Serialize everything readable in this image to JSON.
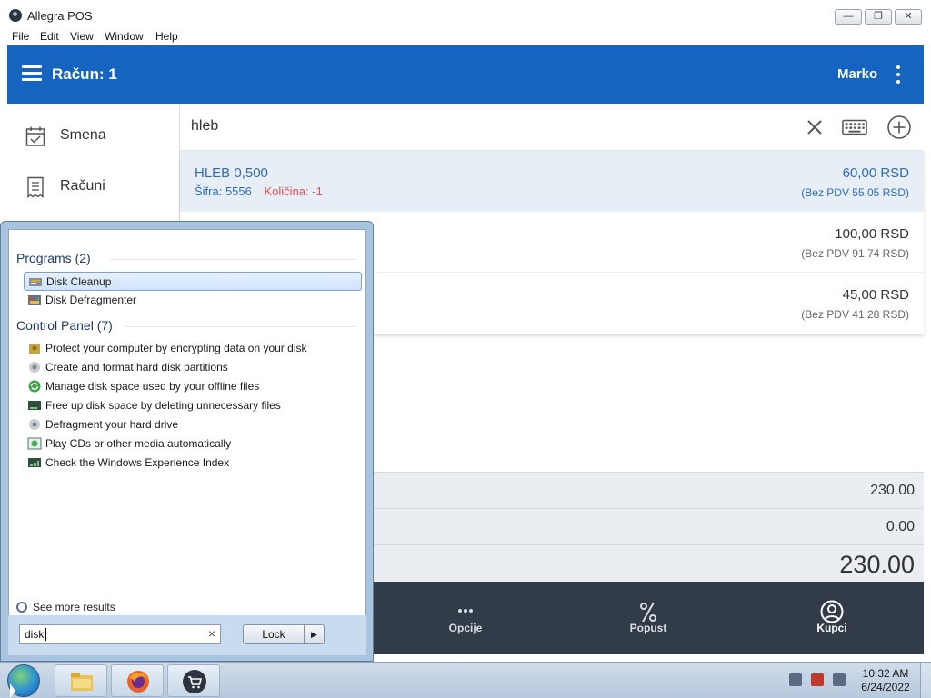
{
  "window": {
    "title": "Allegra POS",
    "controls": [
      "—",
      "❐",
      "✕"
    ]
  },
  "menu": [
    "File",
    "Edit",
    "View",
    "Window",
    "Help"
  ],
  "header": {
    "title": "Račun: 1",
    "user": "Marko"
  },
  "nav": [
    {
      "label": "Smena",
      "icon": "calendar-check-icon"
    },
    {
      "label": "Računi",
      "icon": "receipt-icon"
    }
  ],
  "search": {
    "query": "hleb"
  },
  "items": [
    {
      "name": "HLEB 0,500",
      "code_label": "Šifra: 5556",
      "qty_label": "Količina: -1",
      "price": "60,00 RSD",
      "net": "(Bez PDV 55,05 RSD)"
    },
    {
      "name": "",
      "price": "100,00 RSD",
      "net": "(Bez PDV 91,74 RSD)"
    },
    {
      "name": "",
      "price": "45,00 RSD",
      "net": "(Bez PDV 41,28 RSD)"
    }
  ],
  "totals": [
    "230.00",
    "0.00",
    "230.00"
  ],
  "actions": [
    {
      "label": "Opcije",
      "icon": "more-icon"
    },
    {
      "label": "Popust",
      "icon": "percent-icon"
    },
    {
      "label": "Kupci",
      "icon": "user-circle-icon"
    }
  ],
  "startmenu": {
    "programs_header": "Programs (2)",
    "programs": [
      "Disk Cleanup",
      "Disk Defragmenter"
    ],
    "control_header": "Control Panel (7)",
    "control": [
      "Protect your computer by encrypting data on your disk",
      "Create and format hard disk partitions",
      "Manage disk space used by your offline files",
      "Free up disk space by deleting unnecessary files",
      "Defragment your hard drive",
      "Play CDs or other media automatically",
      "Check the Windows Experience Index"
    ],
    "see_more": "See more results",
    "search_value": "disk",
    "lock_label": "Lock"
  },
  "taskbar": {
    "time": "10:32 AM",
    "date": "6/24/2022"
  },
  "colors": {
    "accent": "#1565c0",
    "action_bar": "#323c48",
    "link": "#2d6db5",
    "negative": "#e15151"
  }
}
